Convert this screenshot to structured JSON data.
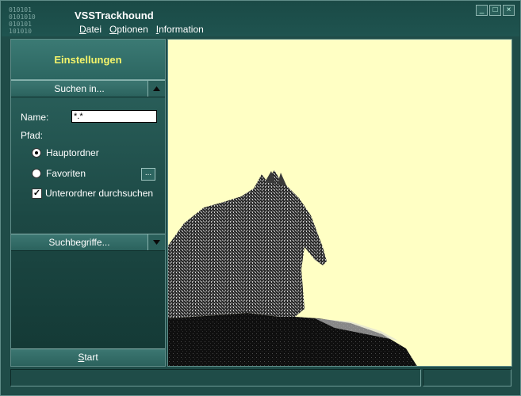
{
  "window": {
    "title": "VSSTrackhound",
    "logo_rows": [
      "010101",
      "0101010",
      "010101",
      "101010"
    ],
    "controls": {
      "minimize": "_",
      "maximize": "□",
      "close": "×"
    }
  },
  "menu": {
    "items": [
      {
        "label": "Datei",
        "mnemonic": "D",
        "rest": "atei"
      },
      {
        "label": "Optionen",
        "mnemonic": "O",
        "rest": "ptionen"
      },
      {
        "label": "Information",
        "mnemonic": "I",
        "rest": "nformation"
      }
    ]
  },
  "sidebar": {
    "header": "Einstellungen",
    "search_in": {
      "label": "Suchen in...",
      "expanded": true,
      "name_label": "Name:",
      "name_value": "*.*",
      "path_label": "Pfad:",
      "options": [
        {
          "label": "Hauptordner",
          "checked": true
        },
        {
          "label": "Favoriten",
          "checked": false
        }
      ],
      "browse_label": "...",
      "subfolders_label": "Unterordner durchsuchen",
      "subfolders_checked": true
    },
    "search_terms": {
      "label": "Suchbegriffe...",
      "expanded": false
    },
    "start": {
      "mnemonic": "S",
      "rest": "tart"
    }
  },
  "status": {
    "pane1": "",
    "pane2": ""
  },
  "colors": {
    "window_bg": "#1f4c48",
    "content_bg": "#ffffc4",
    "header_text": "#f3f36a"
  },
  "icons": {
    "expanded": "triangle-up-icon",
    "collapsed": "triangle-down-icon"
  }
}
